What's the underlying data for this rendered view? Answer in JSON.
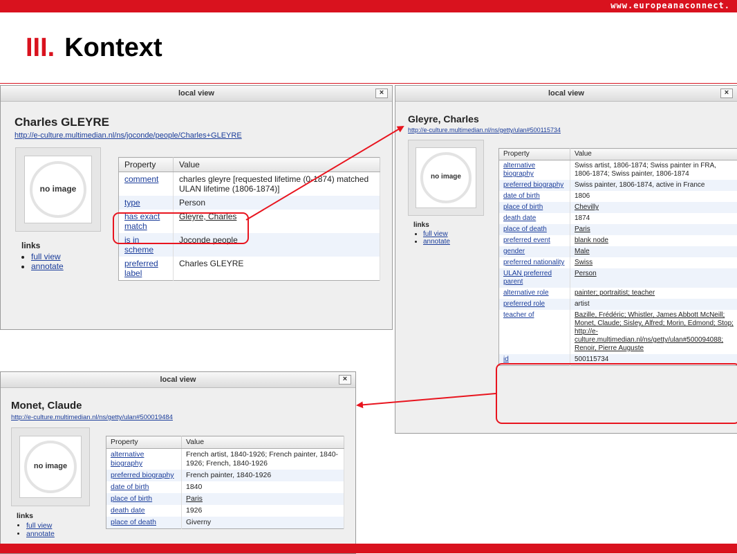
{
  "header": {
    "url": "www.europeanaconnect.",
    "title_number": "III.",
    "title": "Kontext"
  },
  "colors": {
    "brand_red": "#d9121e",
    "link_blue": "#1a3c9a",
    "highlight": "#e8141e"
  },
  "windows": [
    {
      "title": "local view",
      "close": "×",
      "name": "Charles GLEYRE",
      "uri": "http://e-culture.multimedian.nl/ns/joconde/people/Charles+GLEYRE",
      "image_placeholder": "no image",
      "links_heading": "links",
      "links": [
        "full view",
        "annotate"
      ],
      "col_property": "Property",
      "col_value": "Value",
      "rows": [
        {
          "k": "comment",
          "v": "charles gleyre [requested lifetime (0-1874) matched ULAN lifetime (1806-1874)]"
        },
        {
          "k": "type",
          "v": "Person"
        },
        {
          "k": "has exact match",
          "v": "Gleyre, Charles"
        },
        {
          "k": "is in scheme",
          "v": "Joconde people"
        },
        {
          "k": "preferred label",
          "v": "Charles GLEYRE"
        }
      ]
    },
    {
      "title": "local view",
      "close": "×",
      "name": "Gleyre, Charles",
      "uri": "http://e-culture.multimedian.nl/ns/getty/ulan#500115734",
      "image_placeholder": "no image",
      "links_heading": "links",
      "links": [
        "full view",
        "annotate"
      ],
      "col_property": "Property",
      "col_value": "Value",
      "rows": [
        {
          "k": "alternative biography",
          "v": "Swiss artist, 1806-1874; Swiss painter in FRA, 1806-1874; Swiss painter, 1806-1874"
        },
        {
          "k": "preferred biography",
          "v": "Swiss painter, 1806-1874, active in France"
        },
        {
          "k": "date of birth",
          "v": "1806"
        },
        {
          "k": "place of birth",
          "v": "Chevilly"
        },
        {
          "k": "death date",
          "v": "1874"
        },
        {
          "k": "place of death",
          "v": "Paris"
        },
        {
          "k": "preferred event",
          "v": "blank node"
        },
        {
          "k": "gender",
          "v": "Male"
        },
        {
          "k": "preferred nationality",
          "v": "Swiss"
        },
        {
          "k": "ULAN preferred parent",
          "v": "Person"
        },
        {
          "k": "alternative role",
          "v": "painter; portraitist; teacher"
        },
        {
          "k": "preferred role",
          "v": "artist"
        },
        {
          "k": "teacher of",
          "v": "Bazille, Frédéric; Whistler, James Abbott McNeill; Monet, Claude; Sisley, Alfred; Morin, Edmond; Stop; http://e-culture.multimedian.nl/ns/getty/ulan#500094088; Renoir, Pierre Auguste"
        },
        {
          "k": "id",
          "v": "500115734"
        }
      ]
    },
    {
      "title": "local view",
      "close": "×",
      "name": "Monet, Claude",
      "uri": "http://e-culture.multimedian.nl/ns/getty/ulan#500019484",
      "image_placeholder": "no image",
      "links_heading": "links",
      "links": [
        "full view",
        "annotate"
      ],
      "col_property": "Property",
      "col_value": "Value",
      "rows": [
        {
          "k": "alternative biography",
          "v": "French artist, 1840-1926; French painter, 1840-1926; French, 1840-1926"
        },
        {
          "k": "preferred biography",
          "v": "French painter, 1840-1926"
        },
        {
          "k": "date of birth",
          "v": "1840"
        },
        {
          "k": "place of birth",
          "v": "Paris"
        },
        {
          "k": "death date",
          "v": "1926"
        },
        {
          "k": "place of death",
          "v": "Giverny"
        }
      ]
    }
  ]
}
